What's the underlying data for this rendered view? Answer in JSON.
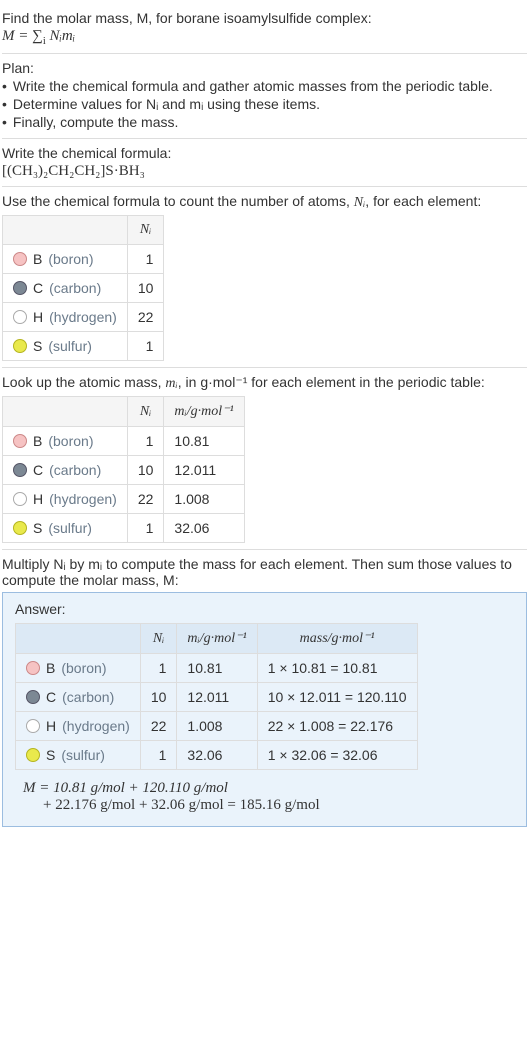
{
  "intro": {
    "line1": "Find the molar mass, M, for borane isoamylsulfide complex:",
    "eq_lhs": "M = ",
    "eq_sum": "∑",
    "eq_sub": "i",
    "eq_rhs": " Nᵢmᵢ"
  },
  "plan": {
    "heading": "Plan:",
    "b1": "Write the chemical formula and gather atomic masses from the periodic table.",
    "b2": "Determine values for Nᵢ and mᵢ using these items.",
    "b3": "Finally, compute the mass."
  },
  "chem": {
    "heading": "Write the chemical formula:",
    "formula_html": "[(CH₃)₂CH₂CH₂]S·BH₃"
  },
  "count": {
    "heading_a": "Use the chemical formula to count the number of atoms, ",
    "heading_b": "Nᵢ",
    "heading_c": ", for each element:",
    "col_n": "Nᵢ"
  },
  "lookup": {
    "heading_a": "Look up the atomic mass, ",
    "heading_b": "mᵢ",
    "heading_c": ", in g·mol⁻¹ for each element in the periodic table:",
    "col_n": "Nᵢ",
    "col_m": "mᵢ/g·mol⁻¹"
  },
  "multiply": {
    "heading": "Multiply Nᵢ by mᵢ to compute the mass for each element. Then sum those values to compute the molar mass, M:"
  },
  "answer": {
    "label": "Answer:",
    "col_n": "Nᵢ",
    "col_m": "mᵢ/g·mol⁻¹",
    "col_mass": "mass/g·mol⁻¹",
    "molar1": "M = 10.81 g/mol + 120.110 g/mol",
    "molar2": "+ 22.176 g/mol + 32.06 g/mol = 185.16 g/mol"
  },
  "elements": {
    "b": {
      "sym": "B",
      "name": "(boron)"
    },
    "c": {
      "sym": "C",
      "name": "(carbon)"
    },
    "h": {
      "sym": "H",
      "name": "(hydrogen)"
    },
    "s": {
      "sym": "S",
      "name": "(sulfur)"
    }
  },
  "chart_data": {
    "type": "table",
    "title": "Molar mass computation for borane isoamylsulfide complex",
    "columns": [
      "element",
      "N_i",
      "m_i_g_per_mol",
      "mass_g_per_mol"
    ],
    "rows": [
      {
        "element": "B (boron)",
        "N_i": 1,
        "m_i_g_per_mol": 10.81,
        "mass_g_per_mol": "1 × 10.81 = 10.81"
      },
      {
        "element": "C (carbon)",
        "N_i": 10,
        "m_i_g_per_mol": 12.011,
        "mass_g_per_mol": "10 × 12.011 = 120.110"
      },
      {
        "element": "H (hydrogen)",
        "N_i": 22,
        "m_i_g_per_mol": 1.008,
        "mass_g_per_mol": "22 × 1.008 = 22.176"
      },
      {
        "element": "S (sulfur)",
        "N_i": 1,
        "m_i_g_per_mol": 32.06,
        "mass_g_per_mol": "1 × 32.06 = 32.06"
      }
    ],
    "molar_mass_g_per_mol": 185.16
  }
}
